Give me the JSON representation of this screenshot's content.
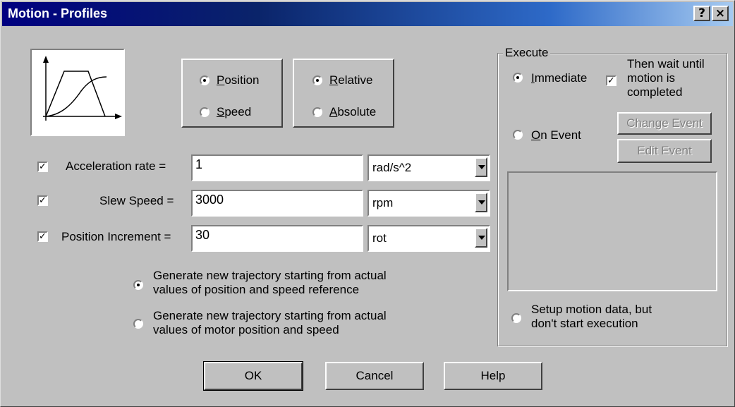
{
  "window": {
    "title": "Motion - Profiles",
    "help_button": "?",
    "close_button": "×"
  },
  "mode": {
    "position": {
      "label": "Position",
      "accel": "P",
      "rest": "osition",
      "selected": true
    },
    "speed": {
      "label": "Speed",
      "accel": "S",
      "rest": "peed",
      "selected": false
    }
  },
  "reference": {
    "relative": {
      "label": "Relative",
      "accel": "R",
      "rest": "elative",
      "selected": true
    },
    "absolute": {
      "label": "Absolute",
      "accel": "A",
      "rest": "bsolute",
      "selected": false
    }
  },
  "params": [
    {
      "label": "Acceleration rate =",
      "checked": true,
      "value": "1",
      "unit": "rad/s^2"
    },
    {
      "label": "Slew Speed =",
      "checked": true,
      "value": "3000",
      "unit": "rpm"
    },
    {
      "label": "Position Increment =",
      "checked": true,
      "value": "30",
      "unit": "rot"
    }
  ],
  "trajectory": {
    "option1": {
      "line1": "Generate new trajectory starting from actual",
      "line2": "values of position and speed reference",
      "selected": true
    },
    "option2": {
      "line1": "Generate new trajectory starting from actual",
      "line2": "values of motor position and speed",
      "selected": false
    }
  },
  "execute": {
    "group_label": "Execute",
    "immediate": {
      "label": "Immediate",
      "accel": "I",
      "rest": "mmediate",
      "selected": true
    },
    "wait": {
      "line1": "Then wait until",
      "line2": "motion is",
      "line3": "completed",
      "checked": true
    },
    "on_event": {
      "label": "On Event",
      "accel": "O",
      "rest": "n Event",
      "selected": false
    },
    "change_event": "Change Event",
    "edit_event": "Edit Event",
    "setup": {
      "line1": "Setup motion data, but",
      "line2": "don't start execution",
      "selected": false
    }
  },
  "buttons": {
    "ok": "OK",
    "cancel": "Cancel",
    "help": "Help"
  },
  "icons": {
    "profile": "motion-profile-graph-icon"
  }
}
